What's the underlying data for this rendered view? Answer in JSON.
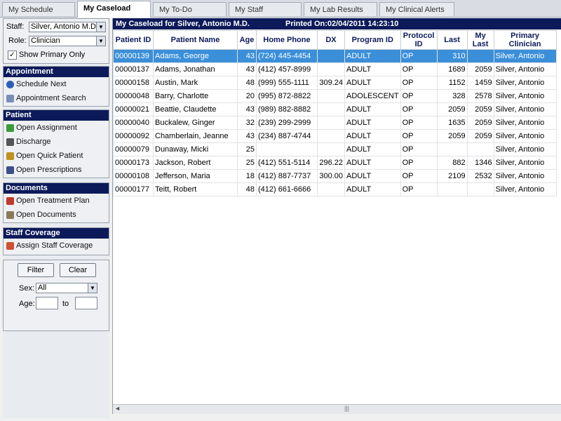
{
  "tabs": [
    "My Schedule",
    "My Caseload",
    "My To-Do",
    "My Staff",
    "My Lab Results",
    "My Clinical Alerts"
  ],
  "active_tab": "My Caseload",
  "filters": {
    "staff_label": "Staff:",
    "staff_value": "Silver, Antonio M.D.",
    "role_label": "Role:",
    "role_value": "Clinician",
    "show_primary_label": "Show Primary Only",
    "show_primary_checked": true
  },
  "sections": {
    "appointment": {
      "title": "Appointment",
      "items": [
        "Schedule Next",
        "Appointment Search"
      ]
    },
    "patient": {
      "title": "Patient",
      "items": [
        "Open Assignment",
        "Discharge",
        "Open Quick Patient",
        "Open Prescriptions"
      ]
    },
    "documents": {
      "title": "Documents",
      "items": [
        "Open Treatment Plan",
        "Open Documents"
      ]
    },
    "staff_coverage": {
      "title": "Staff Coverage",
      "items": [
        "Assign Staff Coverage"
      ]
    }
  },
  "filter_panel": {
    "filter_btn": "Filter",
    "clear_btn": "Clear",
    "sex_label": "Sex:",
    "sex_value": "All",
    "age_label": "Age:",
    "to_label": "to"
  },
  "caseload": {
    "title": "My Caseload for Silver, Antonio M.D.",
    "printed": "Printed On:02/04/2011 14:23:10",
    "columns": [
      "Patient ID",
      "Patient Name",
      "Age",
      "Home Phone",
      "DX",
      "Program ID",
      "Protocol ID",
      "Last",
      "My Last",
      "Primary Clinician"
    ],
    "selected_row": 0,
    "rows": [
      [
        "00000139",
        "Adams, George",
        "43",
        "(724) 445-4454",
        "",
        "ADULT",
        "OP",
        "310",
        "",
        "Silver, Antonio"
      ],
      [
        "00000137",
        "Adams, Jonathan",
        "43",
        "(412) 457-8999",
        "",
        "ADULT",
        "OP",
        "1689",
        "2059",
        "Silver, Antonio"
      ],
      [
        "00000158",
        "Austin, Mark",
        "48",
        "(999) 555-1111",
        "309.24",
        "ADULT",
        "OP",
        "1152",
        "1459",
        "Silver, Antonio"
      ],
      [
        "00000048",
        "Barry, Charlotte",
        "20",
        "(995) 872-8822",
        "",
        "ADOLESCENT",
        "OP",
        "328",
        "2578",
        "Silver, Antonio"
      ],
      [
        "00000021",
        "Beattie, Claudette",
        "43",
        "(989) 882-8882",
        "",
        "ADULT",
        "OP",
        "2059",
        "2059",
        "Silver, Antonio"
      ],
      [
        "00000040",
        "Buckalew, Ginger",
        "32",
        "(239) 299-2999",
        "",
        "ADULT",
        "OP",
        "1635",
        "2059",
        "Silver, Antonio"
      ],
      [
        "00000092",
        "Chamberlain, Jeanne",
        "43",
        "(234) 887-4744",
        "",
        "ADULT",
        "OP",
        "2059",
        "2059",
        "Silver, Antonio"
      ],
      [
        "00000079",
        "Dunaway, Micki",
        "25",
        "",
        "",
        "ADULT",
        "OP",
        "",
        "",
        "Silver, Antonio"
      ],
      [
        "00000173",
        "Jackson, Robert",
        "25",
        "(412) 551-5114",
        "296.22",
        "ADULT",
        "OP",
        "882",
        "1346",
        "Silver, Antonio"
      ],
      [
        "00000108",
        "Jefferson, Maria",
        "18",
        "(412) 887-7737",
        "300.00",
        "ADULT",
        "OP",
        "2109",
        "2532",
        "Silver, Antonio"
      ],
      [
        "00000177",
        "Teitt, Robert",
        "48",
        "(412) 661-6666",
        "",
        "ADULT",
        "OP",
        "",
        "",
        "Silver, Antonio"
      ]
    ]
  },
  "colors": {
    "header_bg": "#0c1a5a",
    "selected_row": "#3b8fd9"
  }
}
